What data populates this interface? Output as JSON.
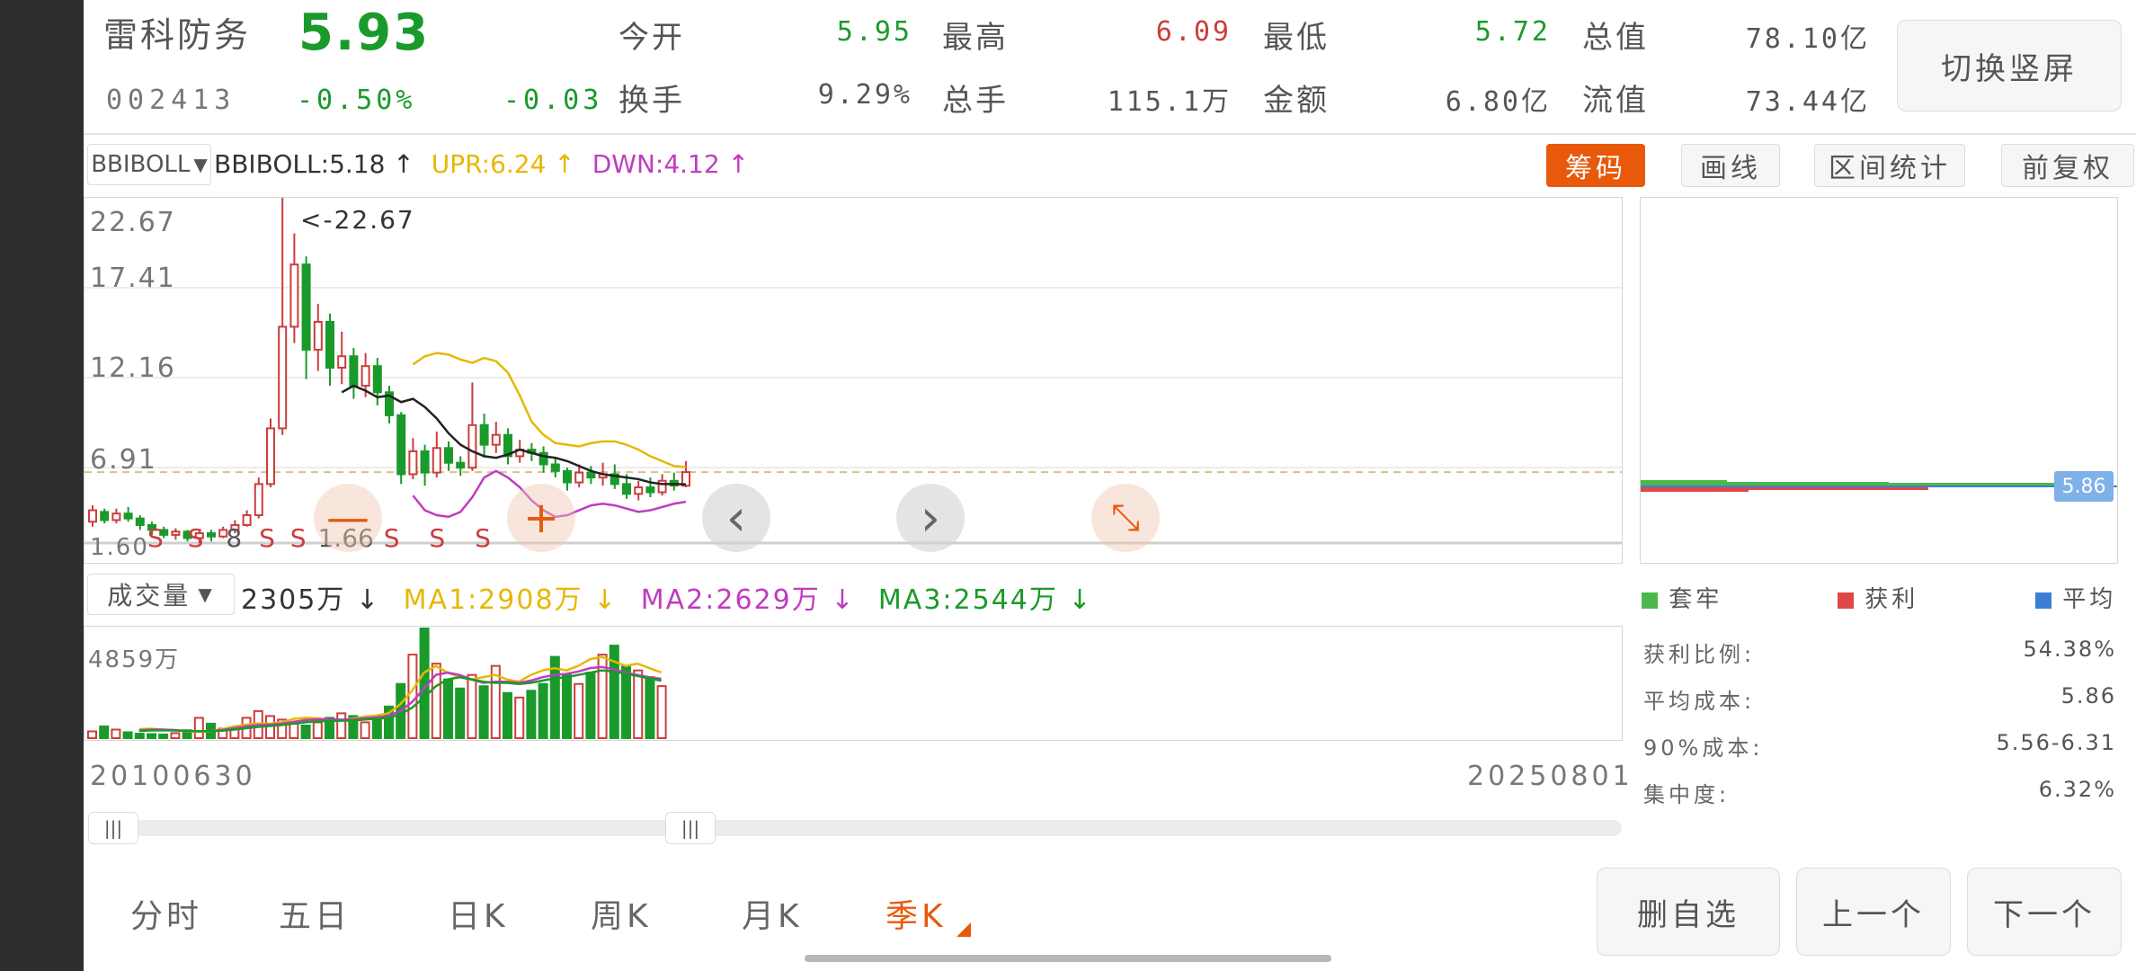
{
  "stock": {
    "name": "雷科防务",
    "price": "5.93",
    "code": "002413",
    "change_pct": "-0.50%",
    "change": "-0.03",
    "open_label": "今开",
    "open": "5.95",
    "high_label": "最高",
    "high": "6.09",
    "low_label": "最低",
    "low": "5.72",
    "total_cap_label": "总值",
    "total_cap": "78.10亿",
    "turnover_label": "换手",
    "turnover": "9.29%",
    "volume_label": "总手",
    "volume": "115.1万",
    "amount_label": "金额",
    "amount": "6.80亿",
    "float_cap_label": "流值",
    "float_cap": "73.44亿"
  },
  "switch_screen_label": "切换竖屏",
  "indicator": {
    "selector": "BBIBOLL",
    "bbiboll": "BBIBOLL:5.18 ↑",
    "upr": "UPR:6.24 ↑",
    "dwn": "DWN:4.12 ↑"
  },
  "toolbar": {
    "chips": "筹码",
    "draw": "画线",
    "interval_stats": "区间统计",
    "adjust": "前复权"
  },
  "main_chart": {
    "y_ticks": [
      "22.67",
      "17.41",
      "12.16",
      "6.91",
      "1.60"
    ],
    "max_marker": "<-22.67",
    "low_marker": "1.66",
    "signals": [
      "S",
      "S",
      "S",
      "S",
      "S",
      "S",
      "S"
    ],
    "signal_digit": "8",
    "dashed_price": 5.93
  },
  "chart_controls": {
    "minus": "—",
    "plus": "+",
    "prev": "‹",
    "next": "›",
    "collapse": "⤡"
  },
  "volume": {
    "selector": "成交量",
    "value": "2305万 ↓",
    "ma1": "MA1:2908万 ↓",
    "ma2": "MA2:2629万 ↓",
    "ma3": "MA3:2544万 ↓",
    "max_label": "4859万"
  },
  "date_range": {
    "start": "20100630",
    "end": "20250801"
  },
  "chips_panel": {
    "avg_price_tag": "5.86",
    "legend": {
      "trapped": "套牢",
      "profit": "获利",
      "average": "平均"
    },
    "stats": [
      {
        "label": "获利比例:",
        "value": "54.38%"
      },
      {
        "label": "平均成本:",
        "value": "5.86"
      },
      {
        "label": "90%成本:",
        "value": "5.56-6.31"
      },
      {
        "label": "集中度:",
        "value": "6.32%"
      }
    ]
  },
  "period_tabs": [
    "分时",
    "五日",
    "日K",
    "周K",
    "月K",
    "季K"
  ],
  "active_tab": "季K",
  "bottom_buttons": {
    "delete_watch": "删自选",
    "prev_stock": "上一个",
    "next_stock": "下一个"
  },
  "colors": {
    "up": "#cc3d3d",
    "down": "#1a9a2a",
    "accent": "#e8590c",
    "upr": "#e6b800",
    "dwn": "#c03cc0",
    "mid": "#222222",
    "avg": "#3b7fd4"
  },
  "chart_data": {
    "type": "candlestick",
    "period": "quarterly",
    "y_range": [
      1.6,
      22.67
    ],
    "candles": [
      {
        "o": 2.9,
        "c": 3.6,
        "h": 3.9,
        "l": 2.6
      },
      {
        "o": 3.5,
        "c": 3.0,
        "h": 3.7,
        "l": 2.8
      },
      {
        "o": 3.0,
        "c": 3.4,
        "h": 3.7,
        "l": 2.8
      },
      {
        "o": 3.4,
        "c": 3.1,
        "h": 3.8,
        "l": 2.9
      },
      {
        "o": 3.1,
        "c": 2.7,
        "h": 3.3,
        "l": 2.4
      },
      {
        "o": 2.7,
        "c": 2.4,
        "h": 2.9,
        "l": 2.1
      },
      {
        "o": 2.4,
        "c": 2.1,
        "h": 2.6,
        "l": 1.9
      },
      {
        "o": 2.1,
        "c": 2.3,
        "h": 2.5,
        "l": 1.8
      },
      {
        "o": 2.3,
        "c": 1.9,
        "h": 2.4,
        "l": 1.7
      },
      {
        "o": 1.9,
        "c": 2.2,
        "h": 2.4,
        "l": 1.6
      },
      {
        "o": 2.2,
        "c": 2.0,
        "h": 2.4,
        "l": 1.7
      },
      {
        "o": 2.0,
        "c": 2.4,
        "h": 2.6,
        "l": 1.9
      },
      {
        "o": 2.4,
        "c": 2.7,
        "h": 3.0,
        "l": 2.2
      },
      {
        "o": 2.7,
        "c": 3.3,
        "h": 3.6,
        "l": 2.6
      },
      {
        "o": 3.3,
        "c": 5.2,
        "h": 5.6,
        "l": 3.1
      },
      {
        "o": 5.2,
        "c": 8.6,
        "h": 9.2,
        "l": 5.0
      },
      {
        "o": 8.6,
        "c": 14.8,
        "h": 22.67,
        "l": 8.2
      },
      {
        "o": 14.8,
        "c": 18.6,
        "h": 20.5,
        "l": 13.8
      },
      {
        "o": 18.6,
        "c": 13.4,
        "h": 19.1,
        "l": 11.6
      },
      {
        "o": 13.4,
        "c": 15.1,
        "h": 16.2,
        "l": 12.1
      },
      {
        "o": 15.1,
        "c": 12.3,
        "h": 15.6,
        "l": 11.2
      },
      {
        "o": 12.3,
        "c": 13.0,
        "h": 14.5,
        "l": 11.3
      },
      {
        "o": 13.0,
        "c": 11.2,
        "h": 13.5,
        "l": 10.4
      },
      {
        "o": 11.2,
        "c": 12.4,
        "h": 13.2,
        "l": 10.5
      },
      {
        "o": 12.4,
        "c": 10.8,
        "h": 12.9,
        "l": 10.0
      },
      {
        "o": 10.8,
        "c": 9.4,
        "h": 11.2,
        "l": 8.9
      },
      {
        "o": 9.4,
        "c": 5.8,
        "h": 9.6,
        "l": 5.2
      },
      {
        "o": 5.8,
        "c": 7.2,
        "h": 8.0,
        "l": 5.5
      },
      {
        "o": 7.2,
        "c": 5.9,
        "h": 7.6,
        "l": 5.1
      },
      {
        "o": 5.9,
        "c": 7.4,
        "h": 8.4,
        "l": 5.6
      },
      {
        "o": 7.4,
        "c": 6.5,
        "h": 7.8,
        "l": 6.0
      },
      {
        "o": 6.5,
        "c": 6.2,
        "h": 6.9,
        "l": 5.7
      },
      {
        "o": 6.2,
        "c": 8.8,
        "h": 11.4,
        "l": 6.0
      },
      {
        "o": 8.8,
        "c": 7.6,
        "h": 9.5,
        "l": 6.8
      },
      {
        "o": 7.6,
        "c": 8.2,
        "h": 9.0,
        "l": 7.1
      },
      {
        "o": 8.2,
        "c": 6.9,
        "h": 8.6,
        "l": 6.4
      },
      {
        "o": 6.9,
        "c": 7.3,
        "h": 7.9,
        "l": 6.5
      },
      {
        "o": 7.3,
        "c": 7.1,
        "h": 7.7,
        "l": 6.6
      },
      {
        "o": 7.1,
        "c": 6.4,
        "h": 7.5,
        "l": 5.9
      },
      {
        "o": 6.4,
        "c": 6.0,
        "h": 6.8,
        "l": 5.6
      },
      {
        "o": 6.0,
        "c": 5.3,
        "h": 6.2,
        "l": 4.8
      },
      {
        "o": 5.3,
        "c": 5.9,
        "h": 6.4,
        "l": 5.0
      },
      {
        "o": 5.9,
        "c": 5.6,
        "h": 6.3,
        "l": 5.2
      },
      {
        "o": 5.6,
        "c": 5.8,
        "h": 6.5,
        "l": 5.1
      },
      {
        "o": 5.8,
        "c": 5.2,
        "h": 6.4,
        "l": 4.9
      },
      {
        "o": 5.2,
        "c": 4.6,
        "h": 5.8,
        "l": 4.3
      },
      {
        "o": 4.6,
        "c": 5.0,
        "h": 5.4,
        "l": 4.2
      },
      {
        "o": 5.0,
        "c": 4.7,
        "h": 5.6,
        "l": 4.4
      },
      {
        "o": 4.7,
        "c": 5.4,
        "h": 5.8,
        "l": 4.5
      },
      {
        "o": 5.4,
        "c": 5.1,
        "h": 5.9,
        "l": 4.8
      },
      {
        "o": 5.1,
        "c": 5.93,
        "h": 6.6,
        "l": 5.0
      }
    ],
    "bbi": [
      10.8,
      11.2,
      10.9,
      10.5,
      10.6,
      10.2,
      10.4,
      9.9,
      9.2,
      8.3,
      7.6,
      7.2,
      6.9,
      6.8,
      7.0,
      7.3,
      7.1,
      6.9,
      6.8,
      6.6,
      6.3,
      6.0,
      5.8,
      5.7,
      5.6,
      5.5,
      5.3,
      5.2,
      5.2,
      5.18
    ],
    "upr": [
      12.5,
      13.0,
      13.2,
      13.1,
      12.8,
      12.6,
      12.9,
      12.7,
      12.0,
      10.6,
      9.0,
      8.2,
      7.7,
      7.6,
      7.5,
      7.7,
      7.8,
      7.8,
      7.6,
      7.3,
      6.9,
      6.6,
      6.3,
      6.24
    ],
    "dwn": [
      4.5,
      3.6,
      3.3,
      3.2,
      3.5,
      4.4,
      5.6,
      6.0,
      5.6,
      5.0,
      4.2,
      3.6,
      3.2,
      3.3,
      3.6,
      3.9,
      4.0,
      3.9,
      3.7,
      3.5,
      3.6,
      3.8,
      4.0,
      4.12
    ],
    "volume_wan": [
      300,
      520,
      380,
      260,
      200,
      180,
      160,
      220,
      350,
      900,
      640,
      420,
      380,
      900,
      1200,
      980,
      820,
      640,
      560,
      700,
      900,
      1100,
      980,
      700,
      800,
      1400,
      2400,
      3700,
      4859,
      3300,
      2600,
      2200,
      2800,
      2300,
      3200,
      2000,
      1800,
      2100,
      2400,
      3600,
      2800,
      2400,
      2900,
      3700,
      4100,
      3200,
      3000,
      2700,
      2305
    ],
    "ma1_wan": [
      400,
      420,
      380,
      350,
      300,
      280,
      300,
      400,
      520,
      600,
      650,
      640,
      700,
      850,
      900,
      880,
      820,
      800,
      860,
      950,
      1000,
      1100,
      1500,
      2100,
      2900,
      3200,
      2900,
      2700,
      2600,
      2700,
      2800,
      2600,
      2500,
      2800,
      3000,
      3100,
      3000,
      3200,
      3500,
      3600,
      3400,
      3200,
      3300,
      3100,
      2908
    ],
    "ma2_wan": [
      350,
      380,
      380,
      360,
      320,
      300,
      310,
      360,
      440,
      520,
      580,
      600,
      640,
      720,
      800,
      830,
      830,
      820,
      830,
      880,
      920,
      980,
      1200,
      1600,
      2200,
      2800,
      2900,
      2800,
      2600,
      2450,
      2500,
      2500,
      2450,
      2550,
      2700,
      2800,
      2850,
      2950,
      3100,
      3150,
      3050,
      2900,
      2800,
      2700,
      2629
    ],
    "ma3_wan": [
      320,
      340,
      350,
      340,
      320,
      310,
      310,
      330,
      380,
      440,
      500,
      540,
      580,
      640,
      700,
      740,
      760,
      770,
      780,
      820,
      860,
      900,
      1050,
      1350,
      1800,
      2300,
      2600,
      2700,
      2600,
      2500,
      2450,
      2450,
      2400,
      2450,
      2550,
      2650,
      2700,
      2800,
      2900,
      3000,
      2950,
      2850,
      2750,
      2650,
      2544
    ],
    "chips_avg_cost": 5.86
  }
}
